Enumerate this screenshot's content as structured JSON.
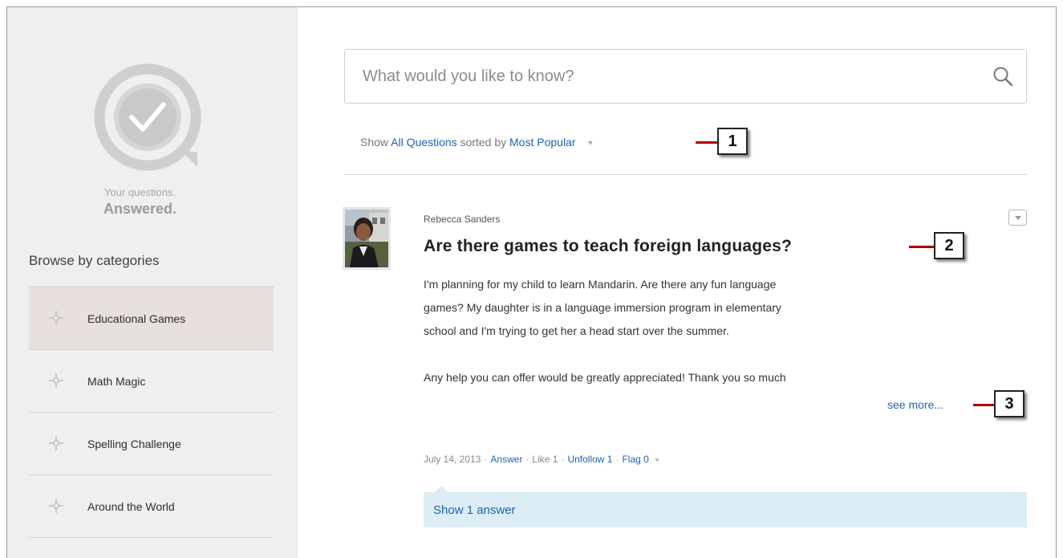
{
  "sidebar": {
    "tagline_line1": "Your questions.",
    "tagline_line2": "Answered.",
    "browse_title": "Browse by categories",
    "categories": [
      {
        "label": "Educational Games"
      },
      {
        "label": "Math Magic"
      },
      {
        "label": "Spelling Challenge"
      },
      {
        "label": "Around the World"
      }
    ],
    "active_category": "Educational Games"
  },
  "search": {
    "placeholder": "What would you like to know?",
    "icon": "search-icon"
  },
  "filter": {
    "show_label": "Show",
    "scope": "All Questions",
    "sorted_label": "sorted by",
    "sort": "Most Popular"
  },
  "post": {
    "author": "Rebecca Sanders",
    "title": "Are there games to teach foreign languages?",
    "body": [
      "I'm planning for my child to learn Mandarin. Are there any fun language",
      "games? My daughter is in a language immersion program in elementary",
      "school and I'm trying to get her a head start over the summer.",
      "Any help you can offer would be greatly appreciated! Thank you so much"
    ],
    "see_more": "see more...",
    "meta": {
      "date": "July 14, 2013",
      "answer": "Answer",
      "like": "Like 1",
      "unfollow": "Unfollow 1",
      "flag": "Flag 0"
    },
    "show_answers": "Show 1 answer"
  },
  "callouts": [
    "1",
    "2",
    "3"
  ],
  "colors": {
    "link": "#1a63b4",
    "sidebar_bg": "#efefef",
    "active_category_bg": "#e8dfdf",
    "answers_bar_bg": "#ddedf6",
    "callout_line": "#b00000"
  }
}
